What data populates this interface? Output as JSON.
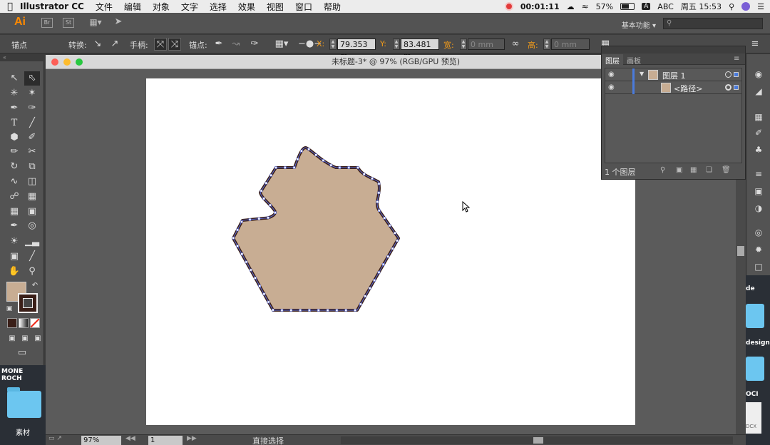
{
  "menubar": {
    "apple": "",
    "app_name": "Illustrator CC",
    "menus": [
      "文件",
      "编辑",
      "对象",
      "文字",
      "选择",
      "效果",
      "视图",
      "窗口",
      "帮助"
    ],
    "timer": "00:01:11",
    "battery": "57%",
    "input_badge": "A",
    "input_label": "ABC",
    "clock": "周五 15:53"
  },
  "appbar": {
    "logo": "Ai",
    "bridge_label": "Br",
    "stock_label": "St",
    "workspace": "基本功能"
  },
  "control": {
    "tool_label": "锚点",
    "convert_label": "转换:",
    "handles_label": "手柄:",
    "anchors_label": "锚点:",
    "x_label": "X:",
    "x_value": "79.353 m",
    "y_label": "Y:",
    "y_value": "83.481 m",
    "w_label": "宽:",
    "w_value": "0 mm",
    "h_label": "高:",
    "h_value": "0 mm"
  },
  "document": {
    "title": "未标题-3* @ 97% (RGB/GPU 预览)",
    "zoom": "97%",
    "page": "1",
    "status": "直接选择"
  },
  "shape": {
    "fill": "#c8ad93",
    "stroke": "#3a1f18",
    "anchor_color": "#5b6bd6"
  },
  "layers": {
    "tab_layers": "图层",
    "tab_artboards": "画板",
    "rows": [
      {
        "name": "图层 1",
        "expanded": true
      },
      {
        "name": "<路径>"
      }
    ],
    "count": "1 个图层"
  },
  "desktop": {
    "left_title": "MONE ROCH",
    "left_folder": "素材",
    "right_items": [
      "de",
      "design",
      "OCI",
      "DCX"
    ]
  }
}
